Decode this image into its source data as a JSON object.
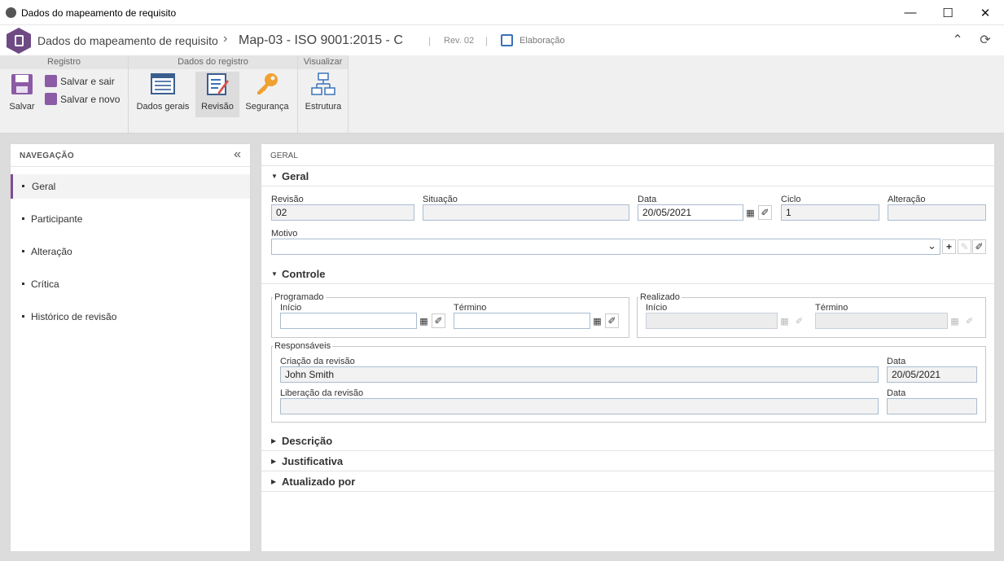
{
  "window": {
    "title": "Dados do mapeamento de requisito",
    "minimize": "—",
    "maximize": "☐",
    "close": "✕"
  },
  "header": {
    "breadcrumb_parent": "Dados do mapeamento de requisito",
    "breadcrumb_sep": "›",
    "record_title": "Map-03 - ISO 9001:2015 - C",
    "separator": "|",
    "revision": "Rev. 02",
    "stage": "Elaboração",
    "collapse_icon": "⌃",
    "refresh_icon": "⟳"
  },
  "ribbon": {
    "groups": [
      {
        "title": "Registro"
      },
      {
        "title": "Dados do registro"
      },
      {
        "title": "Visualizar"
      }
    ],
    "save": "Salvar",
    "save_exit": "Salvar e sair",
    "save_new": "Salvar e novo",
    "general_data": "Dados gerais",
    "revision": "Revisão",
    "security": "Segurança",
    "structure": "Estrutura"
  },
  "nav": {
    "title": "NAVEGAÇÃO",
    "collapse": "«",
    "items": [
      {
        "label": "Geral"
      },
      {
        "label": "Participante"
      },
      {
        "label": "Alteração"
      },
      {
        "label": "Crítica"
      },
      {
        "label": "Histórico de revisão"
      }
    ]
  },
  "content": {
    "header": "GERAL",
    "sections": {
      "geral": "Geral",
      "controle": "Controle",
      "descricao": "Descrição",
      "justificativa": "Justificativa",
      "atualizado": "Atualizado por"
    },
    "arrows": {
      "open": "▼",
      "closed": "▶"
    },
    "geral": {
      "revisao_label": "Revisão",
      "revisao_value": "02",
      "situacao_label": "Situação",
      "situacao_value": "",
      "data_label": "Data",
      "data_value": "20/05/2021",
      "ciclo_label": "Ciclo",
      "ciclo_value": "1",
      "alteracao_label": "Alteração",
      "alteracao_value": "",
      "motivo_label": "Motivo",
      "motivo_value": "",
      "select_arrow": "⌄",
      "add": "+",
      "edit": "✎",
      "clear": "✐"
    },
    "controle": {
      "programado": "Programado",
      "realizado": "Realizado",
      "inicio": "Início",
      "termino": "Término",
      "calendar": "▦",
      "clear": "✐",
      "responsaveis": "Responsáveis",
      "criacao_label": "Criação da revisão",
      "criacao_value": "John Smith",
      "criacao_data_label": "Data",
      "criacao_data_value": "20/05/2021",
      "liberacao_label": "Liberação da revisão",
      "liberacao_value": "",
      "liberacao_data_label": "Data",
      "liberacao_data_value": ""
    }
  }
}
